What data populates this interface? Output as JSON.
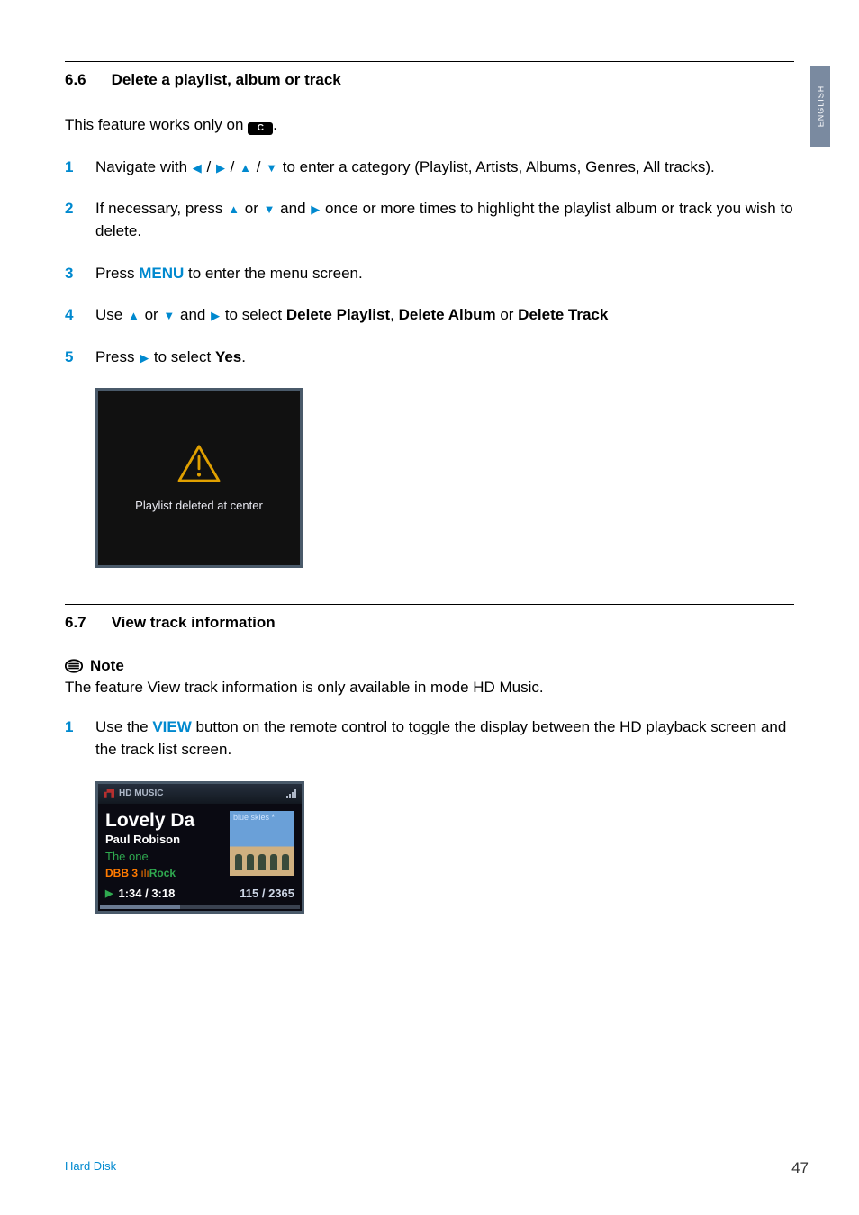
{
  "side_tab": "ENGLISH",
  "section1": {
    "num": "6.6",
    "title": "Delete a playlist, album or track",
    "intro_pre": "This feature works only on ",
    "center_badge": "C",
    "intro_post": ".",
    "steps": [
      {
        "n": "1",
        "pre": "Navigate with ",
        "post": " to enter a category (Playlist, Artists, Albums, Genres, All tracks)."
      },
      {
        "n": "2",
        "pre": "If necessary, press ",
        "mid": " and ",
        "post": " once or more times to highlight the playlist album or track you wish to delete."
      },
      {
        "n": "3",
        "pre": "Press ",
        "menu": "MENU",
        "post": " to enter the menu screen."
      },
      {
        "n": "4",
        "pre": "Use ",
        "mid": " and ",
        "post1": " to select ",
        "b1": "Delete Playlist",
        "sep1": ", ",
        "b2": "Delete Album",
        "sep2": " or ",
        "b3": "Delete Track"
      },
      {
        "n": "5",
        "pre": "Press ",
        "post": " to select ",
        "yes": "Yes",
        "dot": "."
      }
    ],
    "screenshot_text": "Playlist deleted at center"
  },
  "section2": {
    "num": "6.7",
    "title": "View track information",
    "note_label": "Note",
    "note_body": "The feature View track information is only available in mode HD Music.",
    "step": {
      "n": "1",
      "pre": "Use the ",
      "view": "VIEW",
      "post": " button on the remote control to toggle the display between the HD playback screen and the track list screen."
    },
    "screenshot": {
      "header": "HD MUSIC",
      "title": "Lovely Da",
      "artist": "Paul Robison",
      "album": "The one",
      "dbb": "DBB 3",
      "eq": "Rock",
      "art_label": "blue skies *",
      "time": "1:34 / 3:18",
      "count": "115 / 2365"
    }
  },
  "footer": {
    "section_label": "Hard Disk",
    "page": "47"
  }
}
